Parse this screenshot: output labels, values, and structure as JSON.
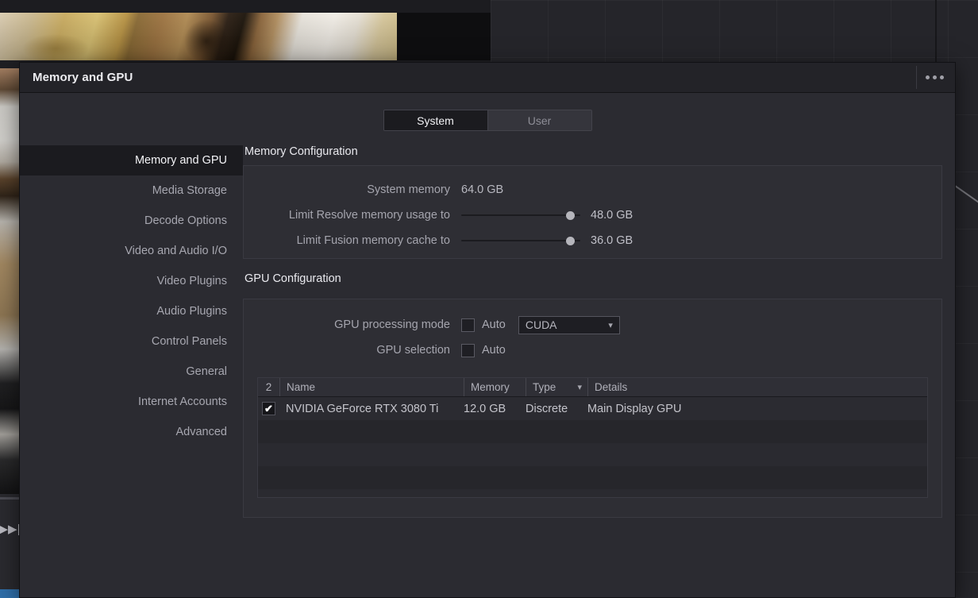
{
  "window": {
    "title": "Memory and GPU",
    "menu_icon": "kebab-menu-icon"
  },
  "tabs": [
    {
      "label": "System",
      "active": true
    },
    {
      "label": "User",
      "active": false
    }
  ],
  "sidebar": {
    "items": [
      {
        "label": "Memory and GPU",
        "active": true
      },
      {
        "label": "Media Storage",
        "active": false
      },
      {
        "label": "Decode Options",
        "active": false
      },
      {
        "label": "Video and Audio I/O",
        "active": false
      },
      {
        "label": "Video Plugins",
        "active": false
      },
      {
        "label": "Audio Plugins",
        "active": false
      },
      {
        "label": "Control Panels",
        "active": false
      },
      {
        "label": "General",
        "active": false
      },
      {
        "label": "Internet Accounts",
        "active": false
      },
      {
        "label": "Advanced",
        "active": false
      }
    ]
  },
  "memory_configuration": {
    "section_title": "Memory Configuration",
    "system_memory": {
      "label": "System memory",
      "value": "64.0 GB"
    },
    "resolve_limit": {
      "label": "Limit Resolve memory usage to",
      "value": "48.0 GB",
      "slider_percent": 95
    },
    "fusion_limit": {
      "label": "Limit Fusion memory cache to",
      "value": "36.0 GB",
      "slider_percent": 95
    }
  },
  "gpu_configuration": {
    "section_title": "GPU Configuration",
    "processing_mode": {
      "label": "GPU processing mode",
      "auto_label": "Auto",
      "auto_checked": false,
      "mode_value": "CUDA",
      "chevron": "chevron-down-icon"
    },
    "gpu_selection": {
      "label": "GPU selection",
      "auto_label": "Auto",
      "auto_checked": false
    },
    "table": {
      "headers": {
        "count": "2",
        "name": "Name",
        "memory": "Memory",
        "type": "Type",
        "details": "Details"
      },
      "type_sort_icon": "chevron-down-icon",
      "rows": [
        {
          "selected": true,
          "check_glyph": "✔",
          "name": "NVIDIA GeForce RTX 3080 Ti",
          "memory": "12.0 GB",
          "type": "Discrete",
          "details": "Main Display GPU"
        }
      ],
      "empty_row_count": 4
    }
  },
  "background": {
    "transport_icon": "skip-to-end-icon",
    "transport_glyph": "▶▶|"
  },
  "colors": {
    "dialog_bg": "#2b2b31",
    "titlebar_bg": "#232328",
    "panel_bg": "#2e2e34",
    "active_item_bg": "#1b1b1f",
    "text_primary": "#ececf0",
    "text_secondary": "#a5a5ae",
    "accent_blue": "#2f6ea8"
  }
}
